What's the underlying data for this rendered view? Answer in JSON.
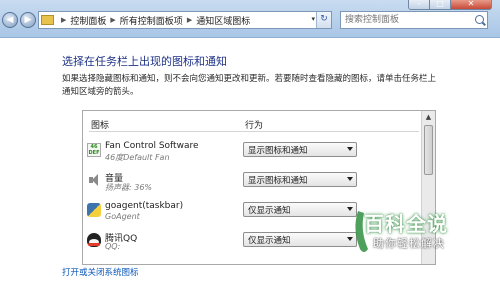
{
  "window": {
    "controls": {
      "minimize": "–",
      "maximize": "□",
      "close": "✕"
    }
  },
  "address_bar": {
    "breadcrumbs": [
      "控制面板",
      "所有控制面板项",
      "通知区域图标"
    ],
    "separator": "▶",
    "dropdown": "▾",
    "refresh": "↻"
  },
  "search": {
    "placeholder": "搜索控制面板"
  },
  "nav": {
    "back": "◀",
    "forward": "▶"
  },
  "content": {
    "title": "选择在任务栏上出现的图标和通知",
    "description": "如果选择隐藏图标和通知，则不会向您通知更改和更新。若要随时查看隐藏的图标，请单击任务栏上通知区域旁的箭头。",
    "columns": {
      "icons": "图标",
      "behavior": "行为"
    },
    "rows": [
      {
        "name": "Fan Control Software",
        "status": "46度Default Fan",
        "behavior": "显示图标和通知",
        "icon": "fan-control-icon",
        "icon_text": "46\nDEF"
      },
      {
        "name": "音量",
        "status": "扬声器: 36%",
        "behavior": "显示图标和通知",
        "icon": "speaker-icon"
      },
      {
        "name": "goagent(taskbar)",
        "status": "GoAgent",
        "behavior": "仅显示通知",
        "icon": "python-icon"
      },
      {
        "name": "腾讯QQ",
        "status": "QQ:",
        "behavior": "仅显示通知",
        "icon": "qq-penguin-icon"
      }
    ],
    "scroll_up": "▲",
    "bottom_link": "打开或关闭系统图标"
  },
  "watermark": {
    "title": "百科全说",
    "subtitle": "助你轻松解决"
  },
  "colors": {
    "title_blue": "#1e3287",
    "link_blue": "#0b57b8",
    "watermark_green": "#2f8f40",
    "close_red": "#c64a36"
  }
}
